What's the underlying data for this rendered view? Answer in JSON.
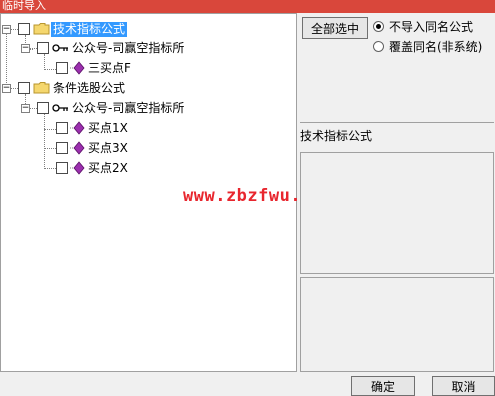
{
  "window": {
    "title": "临时导入"
  },
  "tree": {
    "nodes": [
      {
        "label": "技术指标公式",
        "selected": true
      },
      {
        "label": "公众号-司赢空指标所"
      },
      {
        "label": "三买点F"
      },
      {
        "label": "条件选股公式"
      },
      {
        "label": "公众号-司赢空指标所"
      },
      {
        "label": "买点1X"
      },
      {
        "label": "买点3X"
      },
      {
        "label": "买点2X"
      }
    ]
  },
  "right": {
    "select_all_label": "全部选中",
    "options": [
      {
        "label": "不导入同名公式",
        "checked": true
      },
      {
        "label": "覆盖同名(非系统)",
        "checked": false
      }
    ],
    "info_label": "技术指标公式"
  },
  "watermark": "www.zbzfwu.com",
  "footer": {
    "ok_label": "确定",
    "cancel_label": "取消"
  }
}
